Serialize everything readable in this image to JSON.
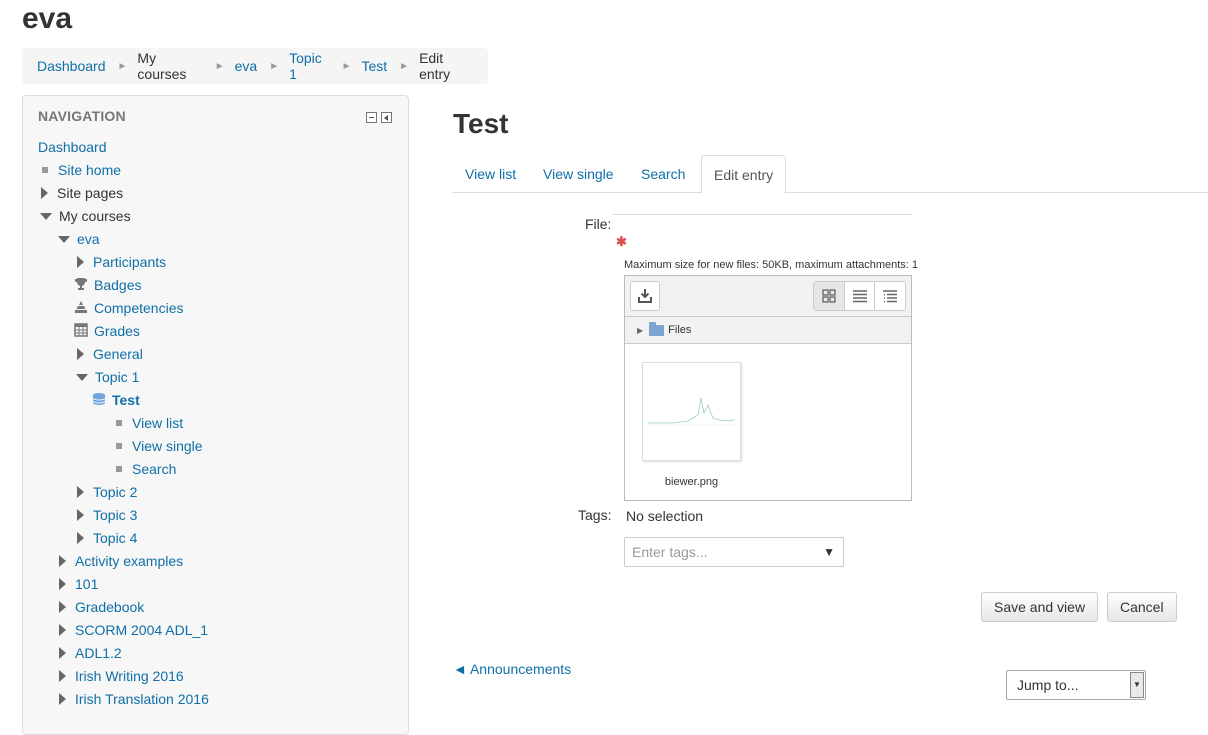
{
  "site_title": "eva",
  "breadcrumb": {
    "items": [
      "Dashboard",
      "My courses",
      "eva",
      "Topic 1",
      "Test",
      "Edit entry"
    ]
  },
  "navigation": {
    "header": "NAVIGATION",
    "items": [
      {
        "label": "Dashboard"
      },
      {
        "label": "Site home"
      },
      {
        "label": "Site pages"
      },
      {
        "label": "My courses"
      },
      {
        "label": "eva"
      },
      {
        "label": "Participants"
      },
      {
        "label": "Badges"
      },
      {
        "label": "Competencies"
      },
      {
        "label": "Grades"
      },
      {
        "label": "General"
      },
      {
        "label": "Topic 1"
      },
      {
        "label": "Test"
      },
      {
        "label": "View list"
      },
      {
        "label": "View single"
      },
      {
        "label": "Search"
      },
      {
        "label": "Topic 2"
      },
      {
        "label": "Topic 3"
      },
      {
        "label": "Topic 4"
      },
      {
        "label": "Activity examples"
      },
      {
        "label": "101"
      },
      {
        "label": "Gradebook"
      },
      {
        "label": "SCORM 2004 ADL_1"
      },
      {
        "label": "ADL1.2"
      },
      {
        "label": "Irish Writing 2016"
      },
      {
        "label": "Irish Translation 2016"
      }
    ]
  },
  "page_title": "Test",
  "tabs": [
    "View list",
    "View single",
    "Search",
    "Edit entry"
  ],
  "form": {
    "file_label": "File:",
    "required_mark": "✱",
    "max_size_note": "Maximum size for new files: 50KB, maximum attachments: 1",
    "folder_label": "Files",
    "file_name": "biewer.png",
    "tags_label": "Tags:",
    "tags_selection": "No selection",
    "tags_placeholder": "Enter tags...",
    "save_button": "Save and view",
    "cancel_button": "Cancel"
  },
  "footer": {
    "prev_link": "◄ Announcements",
    "jump_to": "Jump to..."
  },
  "colors": {
    "link": "#0f6fa7",
    "required": "#d9534f"
  }
}
